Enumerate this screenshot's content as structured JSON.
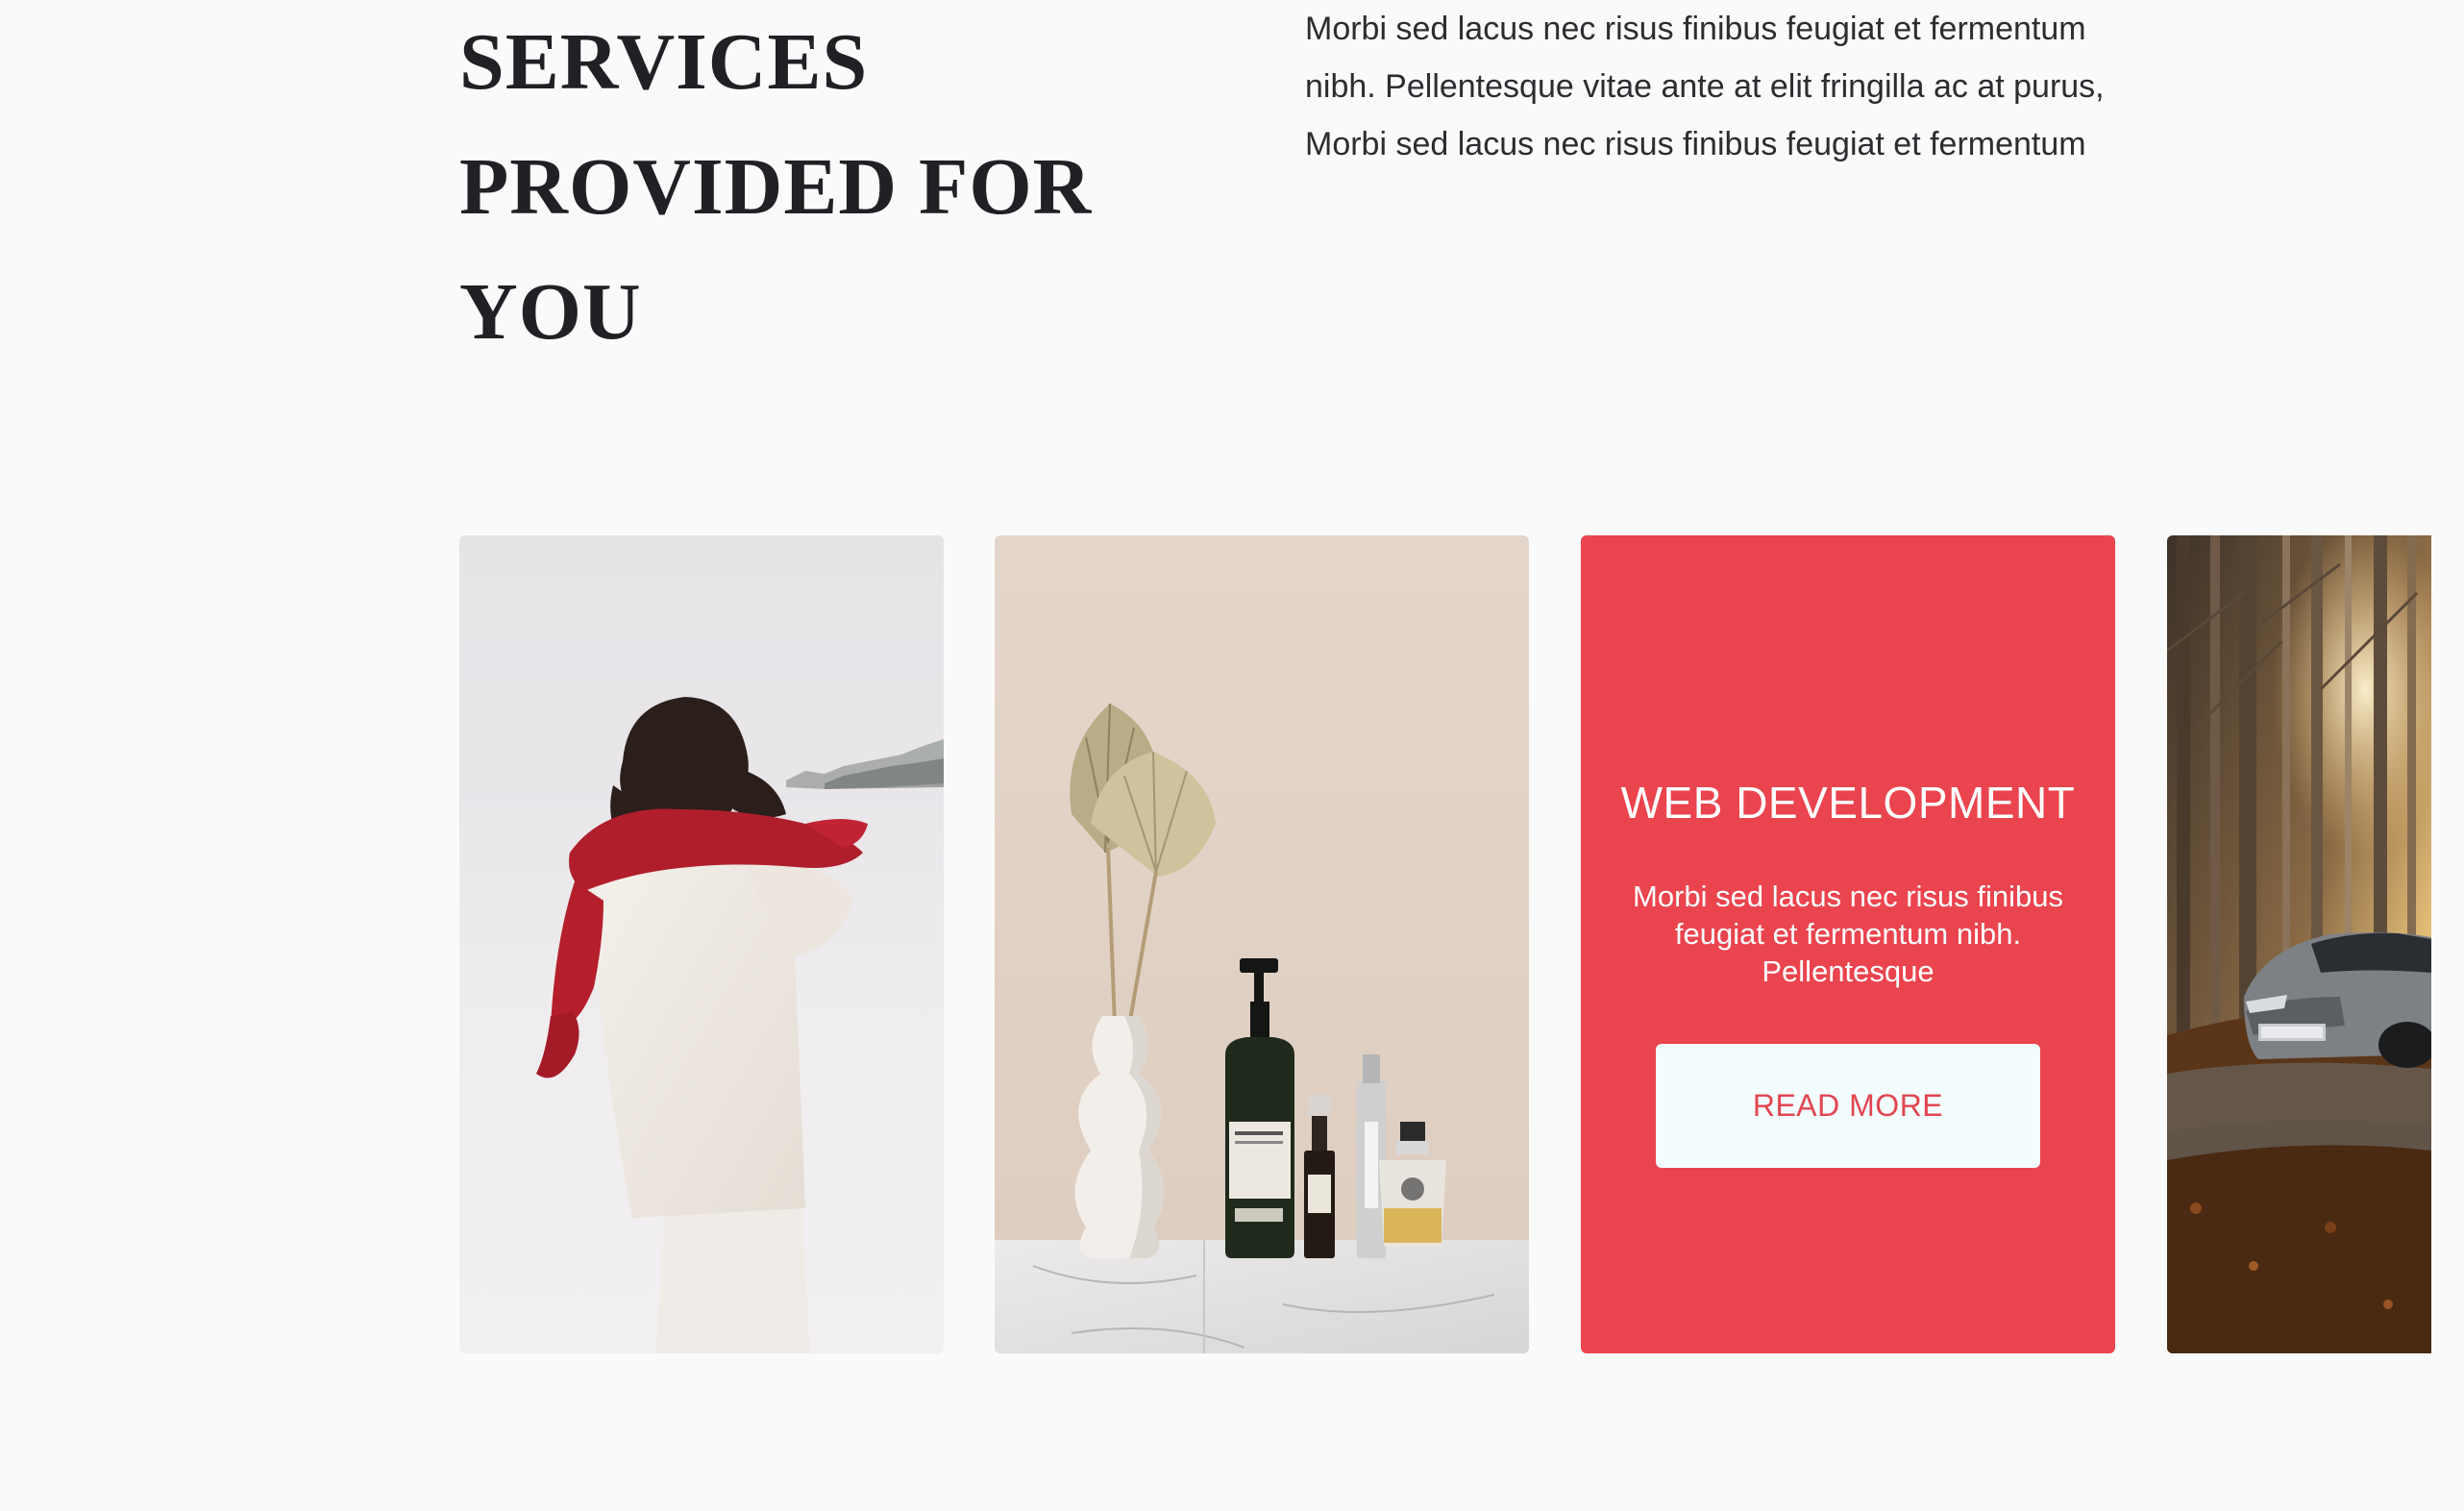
{
  "section": {
    "title_lines": [
      "SERVICES",
      "PROVIDED FOR",
      "YOU"
    ],
    "intro": "Morbi sed lacus nec risus finibus feugiat et fermentum nibh. Pellentesque vitae ante at elit fringilla ac at purus, Morbi sed lacus nec risus finibus feugiat et fermentum"
  },
  "cards": [
    {
      "kind": "image",
      "subject": "woman in red scarf walking through snow"
    },
    {
      "kind": "image",
      "subject": "white vase with dried palm leaves and cosmetic bottles on marble"
    },
    {
      "kind": "featured",
      "heading": "WEB DEVELOPMENT",
      "text": "Morbi sed lacus nec risus finibus feugiat et fermentum nibh. Pellentesque",
      "button_label": "READ MORE"
    },
    {
      "kind": "image",
      "subject": "grey sports car in autumn forest"
    }
  ],
  "colors": {
    "background": "#fafafa",
    "accent": "#ea444e",
    "button_bg": "#f3fdfe",
    "button_text": "#e24550",
    "heading": "#1f2125"
  }
}
